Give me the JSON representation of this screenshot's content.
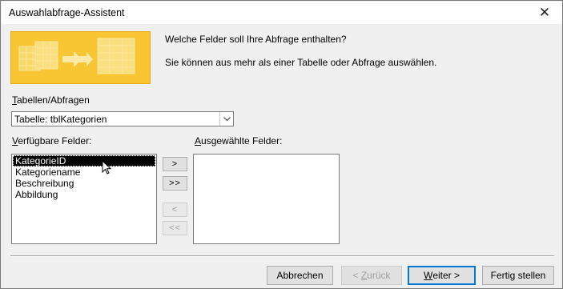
{
  "window": {
    "title": "Auswahlabfrage-Assistent"
  },
  "intro": {
    "heading": "Welche Felder soll Ihre Abfrage enthalten?",
    "description": "Sie können aus mehr als einer Tabelle oder Abfrage auswählen."
  },
  "source": {
    "label_mnemonic": "T",
    "label_rest": "abellen/Abfragen",
    "selected": "Tabelle: tblKategorien"
  },
  "available": {
    "label_mnemonic": "V",
    "label_rest": "erfügbare Felder:",
    "items": [
      "KategorieID",
      "Kategoriename",
      "Beschreibung",
      "Abbildung"
    ],
    "selected_index": 0
  },
  "chosen": {
    "label_mnemonic": "A",
    "label_rest": "usgewählte Felder:",
    "items": []
  },
  "move_buttons": {
    "add_one": ">",
    "add_all": ">>",
    "remove_one": "<",
    "remove_all": "<<"
  },
  "footer": {
    "cancel": "Abbrechen",
    "back_prefix": "< ",
    "back_mnemonic": "Z",
    "back_rest": "urück",
    "next_mnemonic": "W",
    "next_rest": "eiter >",
    "finish": "Fertig stellen"
  },
  "icons": {
    "close": "close-icon",
    "dropdown": "chevron-down-icon",
    "wizard": "wizard-illustration-icon",
    "cursor": "mouse-pointer-icon"
  },
  "colors": {
    "banner": "#f7c632",
    "accent": "#0078d7",
    "selection": "#000000"
  }
}
